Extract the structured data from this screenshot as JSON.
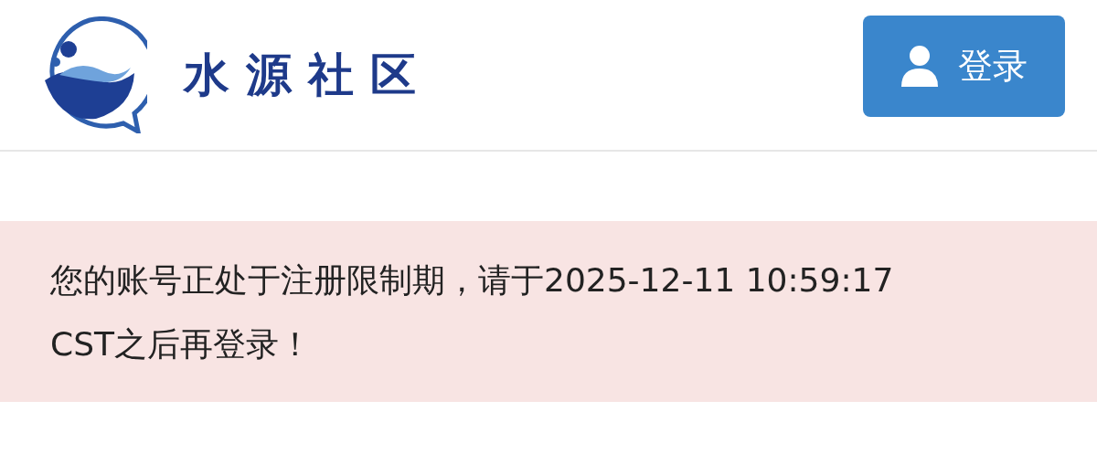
{
  "header": {
    "site_title": "水源社区",
    "login_button": "登录"
  },
  "alert": {
    "message": "您的账号正处于注册限制期，请于2025-12-11 10:59:17 CST之后再登录！"
  }
}
